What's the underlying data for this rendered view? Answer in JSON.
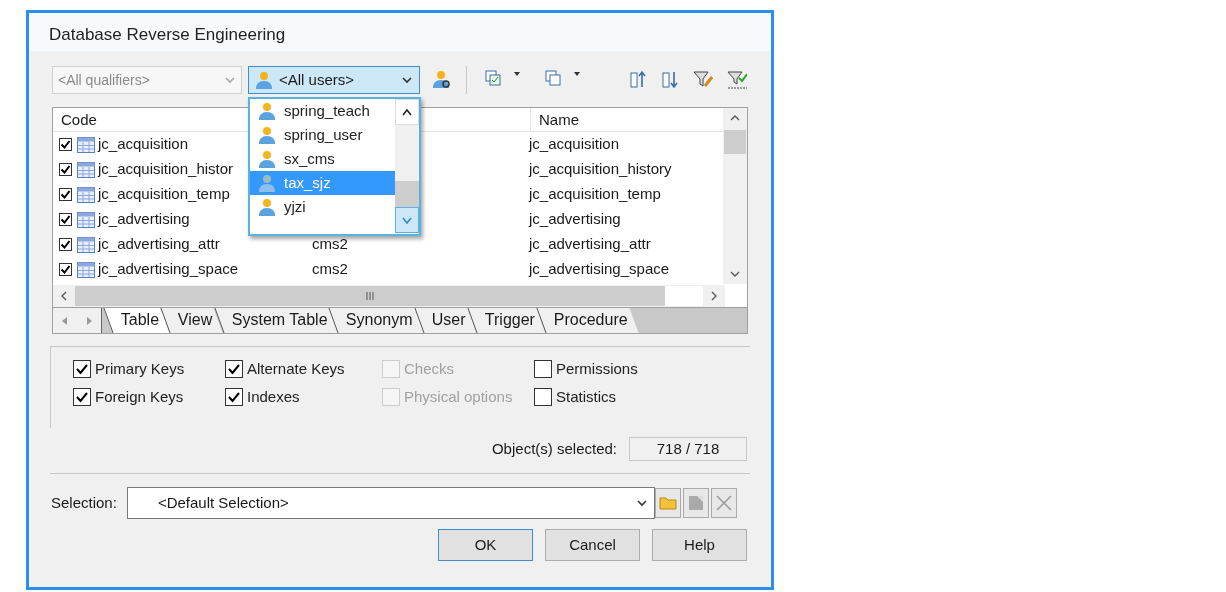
{
  "window": {
    "title": "Database Reverse Engineering"
  },
  "qualifier_combo": {
    "value": "<All qualifiers>",
    "disabled": true
  },
  "owner_combo": {
    "value": "<All users>"
  },
  "owner_list": [
    {
      "label": "spring_teach",
      "selected": false
    },
    {
      "label": "spring_user",
      "selected": false
    },
    {
      "label": "sx_cms",
      "selected": false
    },
    {
      "label": "tax_sjz",
      "selected": true
    },
    {
      "label": "yjzi",
      "selected": false
    }
  ],
  "table": {
    "columns": [
      "Code",
      "Name"
    ],
    "rows": [
      {
        "checked": true,
        "code": "jc_acquisition",
        "name": "jc_acquisition"
      },
      {
        "checked": true,
        "code": "jc_acquisition_histor",
        "name": "jc_acquisition_history"
      },
      {
        "checked": true,
        "code": "jc_acquisition_temp",
        "name": "jc_acquisition_temp"
      },
      {
        "checked": true,
        "code": "jc_advertising",
        "name": "jc_advertising"
      },
      {
        "checked": true,
        "code": "jc_advertising_attr",
        "column_2": "cms2",
        "name": "jc_advertising_attr"
      },
      {
        "checked": true,
        "code": "jc_advertising_space",
        "column_2": "cms2",
        "name": "jc_advertising_space"
      }
    ]
  },
  "tabs": [
    {
      "label": "Table",
      "selected": true
    },
    {
      "label": "View",
      "selected": false
    },
    {
      "label": "System Table",
      "selected": false
    },
    {
      "label": "Synonym",
      "selected": false
    },
    {
      "label": "User",
      "selected": false
    },
    {
      "label": "Trigger",
      "selected": false
    },
    {
      "label": "Procedure",
      "selected": false
    }
  ],
  "options": [
    {
      "label": "Primary Keys",
      "checked": true,
      "disabled": false
    },
    {
      "label": "Foreign Keys",
      "checked": true,
      "disabled": false
    },
    {
      "label": "Alternate Keys",
      "checked": true,
      "disabled": false
    },
    {
      "label": "Indexes",
      "checked": true,
      "disabled": false
    },
    {
      "label": "Checks",
      "checked": false,
      "disabled": true
    },
    {
      "label": "Physical options",
      "checked": false,
      "disabled": true
    },
    {
      "label": "Permissions",
      "checked": false,
      "disabled": false
    },
    {
      "label": "Statistics",
      "checked": false,
      "disabled": false
    }
  ],
  "objects_selected": {
    "label": "Object(s) selected:",
    "value": "718 / 718"
  },
  "selection": {
    "label": "Selection:",
    "value": "<Default Selection>"
  },
  "buttons": [
    {
      "label": "OK",
      "default": true
    },
    {
      "label": "Cancel",
      "default": false
    },
    {
      "label": "Help",
      "default": false
    }
  ]
}
